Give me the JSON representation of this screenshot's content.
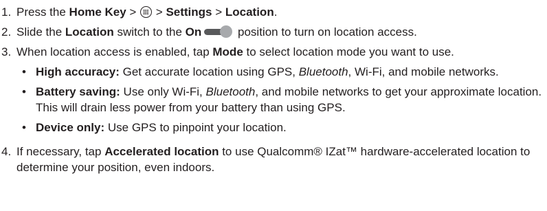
{
  "steps": [
    {
      "num": "1.",
      "t1": "Press the ",
      "b1": "Home Key",
      "t2": " > ",
      "t3": " > ",
      "b2": "Settings",
      "t4": " > ",
      "b3": "Location",
      "t5": "."
    },
    {
      "num": "2.",
      "t1": "Slide the ",
      "b1": "Location",
      "t2": " switch to the ",
      "b2": "On",
      "t3": " position to turn on location access."
    },
    {
      "num": "3.",
      "t1": "When location access is enabled, tap ",
      "b1": "Mode",
      "t2": " to select location mode you want to use.",
      "bullets": [
        {
          "symbol": "•",
          "b1": "High accuracy:",
          "t1": " Get accurate location using GPS, ",
          "i1": "Bluetooth",
          "t2": ", Wi-Fi, and mobile networks."
        },
        {
          "symbol": "•",
          "b1": "Battery saving:",
          "t1": " Use only Wi-Fi, ",
          "i1": "Bluetooth",
          "t2": ", and mobile networks to get your approximate location. This will drain less power from your battery than using GPS."
        },
        {
          "symbol": "•",
          "b1": "Device only:",
          "t1": " Use GPS to pinpoint your location."
        }
      ]
    },
    {
      "num": "4.",
      "t1": "If necessary, tap ",
      "b1": "Accelerated location",
      "t2": " to use Qualcomm® IZat™ hardware-accelerated location to determine your position, even indoors."
    }
  ],
  "icons": {
    "apps": "apps-icon",
    "toggle": "toggle-on-icon"
  },
  "colors": {
    "text": "#231f20",
    "toggle_track": "#58595b",
    "toggle_knob": "#a7a9ac"
  }
}
